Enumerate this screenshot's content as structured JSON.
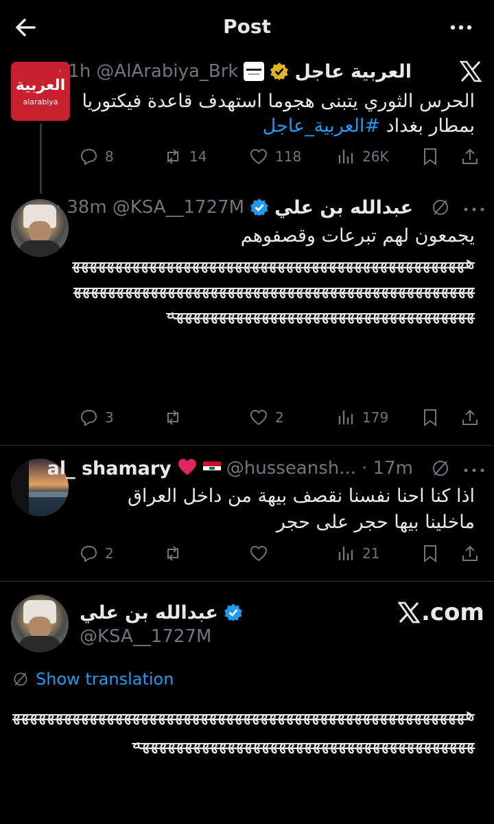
{
  "header": {
    "title": "Post"
  },
  "main_post": {
    "display_name": "العربية عاجل",
    "handle": "@AlArabiya_Brk",
    "time": "· 1h",
    "avatar_logo_text": "العربية",
    "avatar_sub": "alarabiya",
    "text_line1": "الحرس الثوري يتبنى هجوما استهدف قاعدة فيكتوريا",
    "text_line2": "بمطار بغداد",
    "hashtag": "#العربية_عاجل",
    "replies": "8",
    "reposts": "14",
    "likes": "118",
    "views": "26K"
  },
  "reply1": {
    "display_name": "عبدالله بن علي",
    "handle": "@KSA__1727M",
    "time": "· 38m",
    "text_line1": "يجمعون لهم تبرعات وقصفوهم",
    "text_laughs": "هههههههههههههههههههههههههههههههههههههههههههههههههههههههههههههههههههههههههههههههههههههههههههههههههههههههههههههههههههههههههههههههههه",
    "replies": "3",
    "reposts": "",
    "likes": "2",
    "views": "179"
  },
  "reply2": {
    "display_name": "al_ shamary",
    "handle": "@husseansh...",
    "time": "· 17m",
    "text_line1": "اذا كنا احنا نفسنا نقصف بيهة من داخل العراق",
    "text_line2": "ماخلينا بيها حجر على حجر",
    "replies": "2",
    "reposts": "",
    "likes": "",
    "views": "21"
  },
  "card": {
    "display_name": "عبدالله بن علي",
    "handle": "@KSA__1727M",
    "site": ".com",
    "show_translation": "Show translation",
    "text_laughs": "هههههههههههههههههههههههههههههههههههههههههههههههههههههههههههههههههههههههههههههههههههههههههههههه"
  },
  "colors": {
    "accent": "#1d9bf0",
    "muted": "#71767b",
    "background": "#000000",
    "verified_gold": "#e2b719"
  }
}
